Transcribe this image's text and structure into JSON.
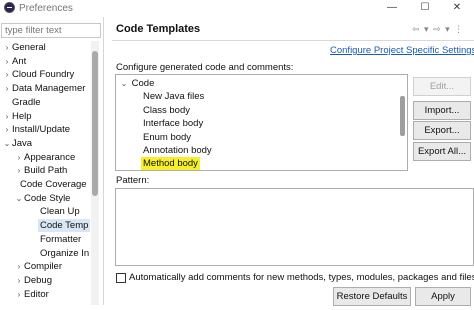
{
  "window": {
    "title": "Preferences",
    "controls": [
      "—",
      "☐",
      "✕"
    ]
  },
  "sidebar": {
    "filter_placeholder": "type filter text",
    "items": [
      {
        "label": "General",
        "arrow": "›"
      },
      {
        "label": "Ant",
        "arrow": "›"
      },
      {
        "label": "Cloud Foundry",
        "arrow": "›"
      },
      {
        "label": "Data Managemer",
        "arrow": "›"
      },
      {
        "label": "Gradle",
        "arrow": ""
      },
      {
        "label": "Help",
        "arrow": "›"
      },
      {
        "label": "Install/Update",
        "arrow": "›"
      },
      {
        "label": "Java",
        "arrow": "⌄"
      },
      {
        "label": "Appearance",
        "arrow": "›"
      },
      {
        "label": "Build Path",
        "arrow": "›"
      },
      {
        "label": "Code Coverage",
        "arrow": ""
      },
      {
        "label": "Code Style",
        "arrow": "⌄"
      },
      {
        "label": "Clean Up",
        "arrow": ""
      },
      {
        "label": "Code Temp",
        "arrow": ""
      },
      {
        "label": "Formatter",
        "arrow": ""
      },
      {
        "label": "Organize In",
        "arrow": ""
      },
      {
        "label": "Compiler",
        "arrow": "›"
      },
      {
        "label": "Debug",
        "arrow": "›"
      },
      {
        "label": "Editor",
        "arrow": "›"
      }
    ]
  },
  "main": {
    "title": "Code Templates",
    "nav_arrows": "⇦ ▾ ⇨ ▾ ⋮",
    "configure_link": "Configure Project Specific Settings...",
    "section_label": "Configure generated code and comments:",
    "tree": {
      "root": "Code",
      "root_arrow": "⌄",
      "items": [
        "New Java files",
        "Class body",
        "Interface body",
        "Enum body",
        "Annotation body",
        "Method body"
      ],
      "highlighted_item": "Method body",
      "highlight_color": "#f6f02a"
    },
    "buttons": {
      "edit": "Edit...",
      "import": "Import...",
      "export": "Export...",
      "export_all": "Export All..."
    },
    "pattern_label": "Pattern:",
    "checkbox_label": "Automatically add comments for new methods, types, modules, packages and files",
    "checkbox_checked": false,
    "restore_defaults": "Restore Defaults",
    "apply": "Apply"
  }
}
